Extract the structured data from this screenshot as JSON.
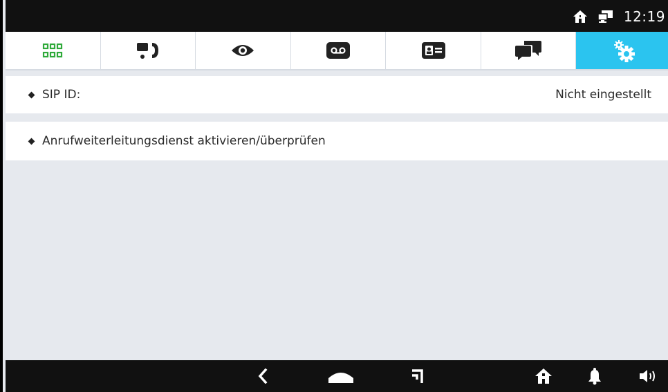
{
  "status_bar": {
    "clock": "12:19",
    "icons": [
      "home-icon",
      "network-icon"
    ]
  },
  "tabs": [
    {
      "name": "apps-grid-icon",
      "active": false
    },
    {
      "name": "intercom-call-icon",
      "active": false
    },
    {
      "name": "eye-icon",
      "active": false
    },
    {
      "name": "voicemail-icon",
      "active": false
    },
    {
      "name": "contact-card-icon",
      "active": false
    },
    {
      "name": "chat-bubbles-icon",
      "active": false
    },
    {
      "name": "settings-gears-icon",
      "active": true
    }
  ],
  "settings": {
    "sip_id_label": "SIP ID:",
    "sip_id_value": "Nicht eingestellt",
    "call_forward_label": "Anrufweiterleitungsdienst aktivieren/überprüfen"
  },
  "nav_bar": {
    "buttons": [
      "back-icon",
      "home-nav-icon",
      "recents-icon",
      "house-icon",
      "bell-icon",
      "volume-icon"
    ]
  },
  "colors": {
    "accent": "#2bc4ef",
    "grid_icon": "#2faa3a",
    "bars": "#111111",
    "content_bg": "#e6e9ee"
  }
}
